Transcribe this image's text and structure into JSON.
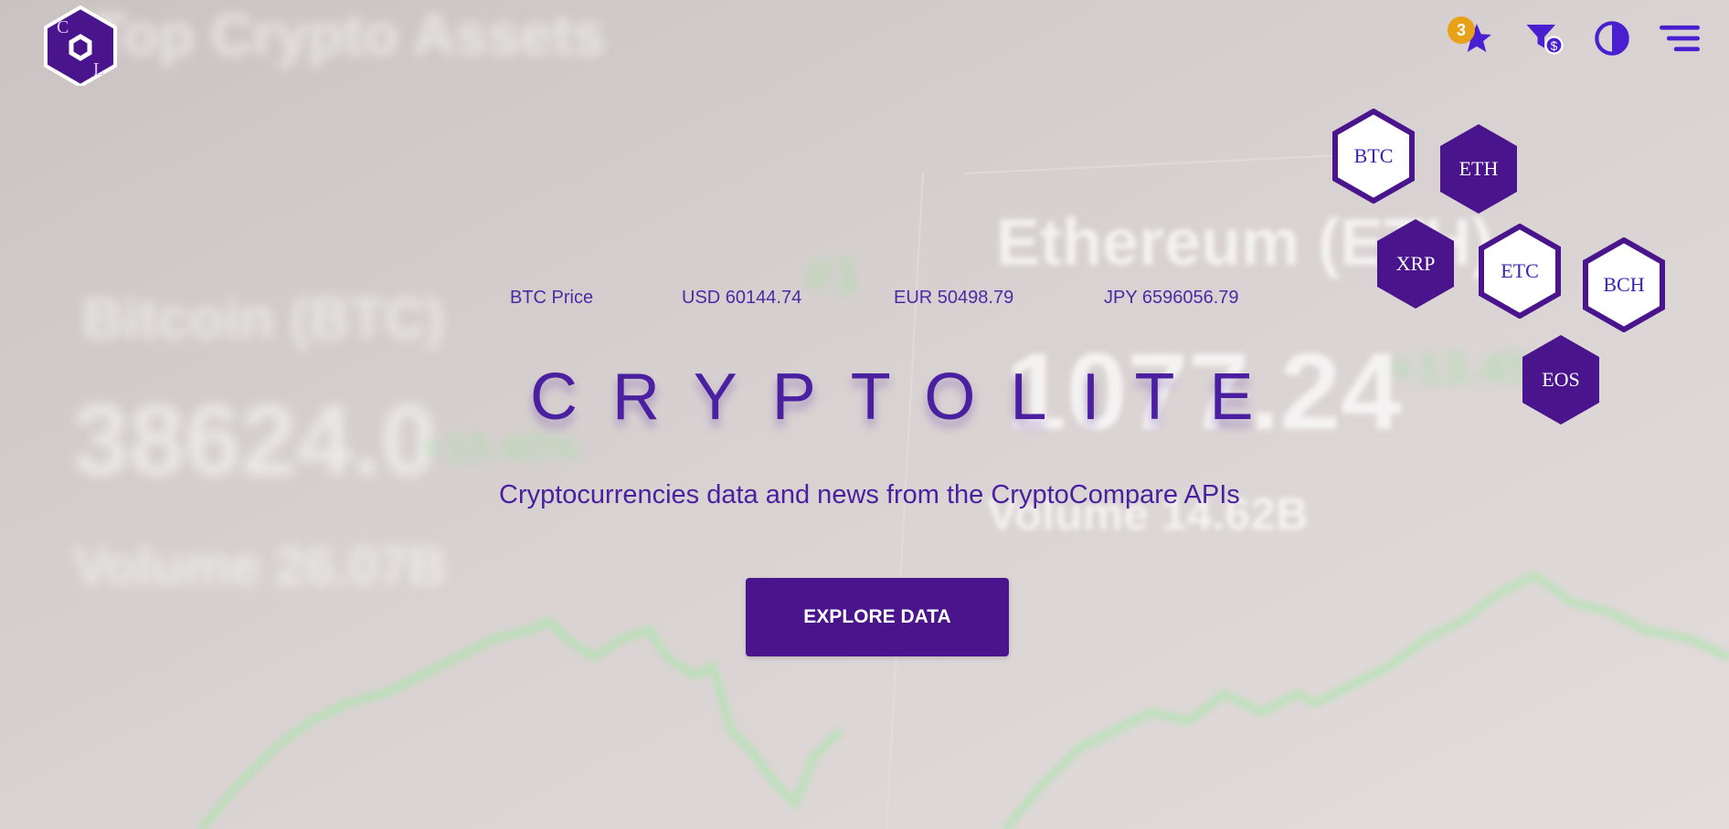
{
  "brand": {
    "logo_letters_top": "C",
    "logo_letters_bottom": "L"
  },
  "nav": {
    "favorites_count": "3",
    "icons": [
      "star-icon",
      "filter-dollar-icon",
      "contrast-icon",
      "menu-icon"
    ]
  },
  "coins": [
    "BTC",
    "ETH",
    "XRP",
    "ETC",
    "BCH",
    "EOS"
  ],
  "prices": {
    "label": "BTC Price",
    "usd": "USD 60144.74",
    "eur": "EUR 50498.79",
    "jpy": "JPY 6596056.79"
  },
  "hero": {
    "title": "CRYPTOLITE",
    "subtitle": "Cryptocurrencies data and news from the CryptoCompare APIs",
    "cta_label": "EXPLORE DATA"
  },
  "colors": {
    "primary": "#4a148c",
    "accent_text": "#4a1fa0",
    "badge": "#e7a21a"
  }
}
